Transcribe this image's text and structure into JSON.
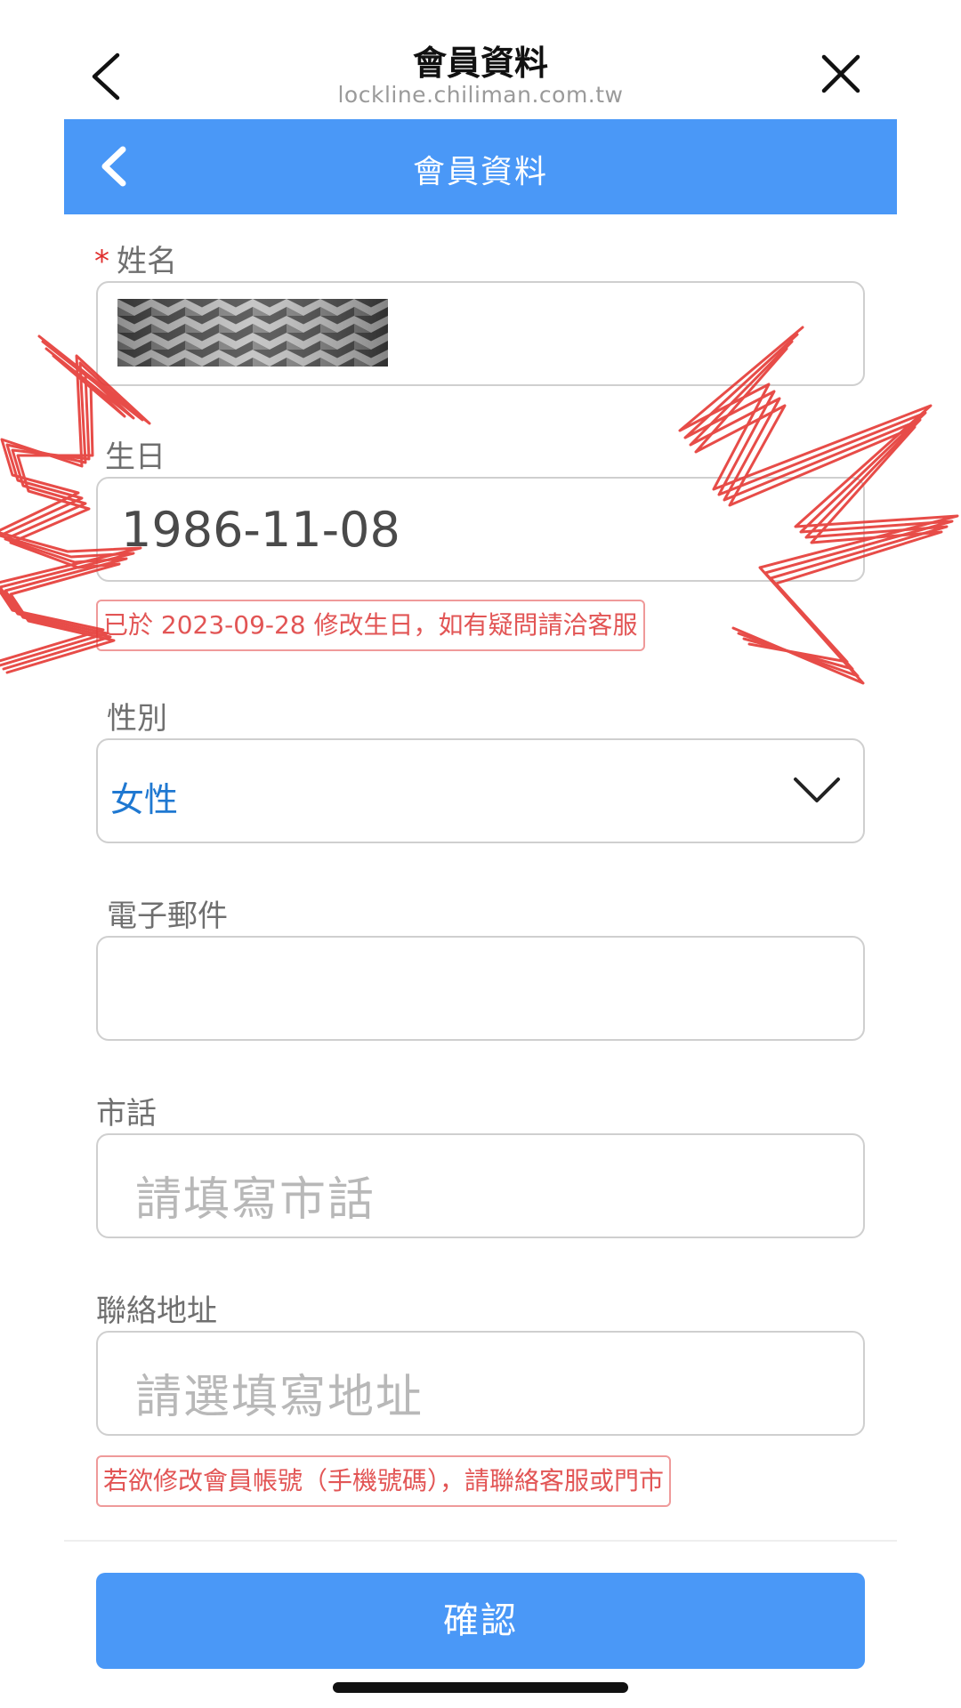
{
  "topbar": {
    "title": "會員資料",
    "url": "lockline.chiliman.com.tw"
  },
  "header": {
    "title": "會員資料"
  },
  "form": {
    "name": {
      "label": "姓名",
      "required_mark": "*"
    },
    "birthday": {
      "label": "生日",
      "value": "1986-11-08",
      "notice": "已於 2023-09-28 修改生日，如有疑問請洽客服"
    },
    "gender": {
      "label": "性別",
      "value": "女性"
    },
    "email": {
      "label": "電子郵件"
    },
    "phone": {
      "label": "市話",
      "placeholder": "請填寫市話"
    },
    "address": {
      "label": "聯絡地址",
      "placeholder": "請選填寫地址"
    },
    "account_notice": "若欲修改會員帳號（手機號碼），請聯絡客服或門市"
  },
  "actions": {
    "confirm_label": "確認"
  },
  "colors": {
    "primary": "#4a98f7",
    "notice": "#e25555",
    "select_text": "#1f78d1"
  }
}
